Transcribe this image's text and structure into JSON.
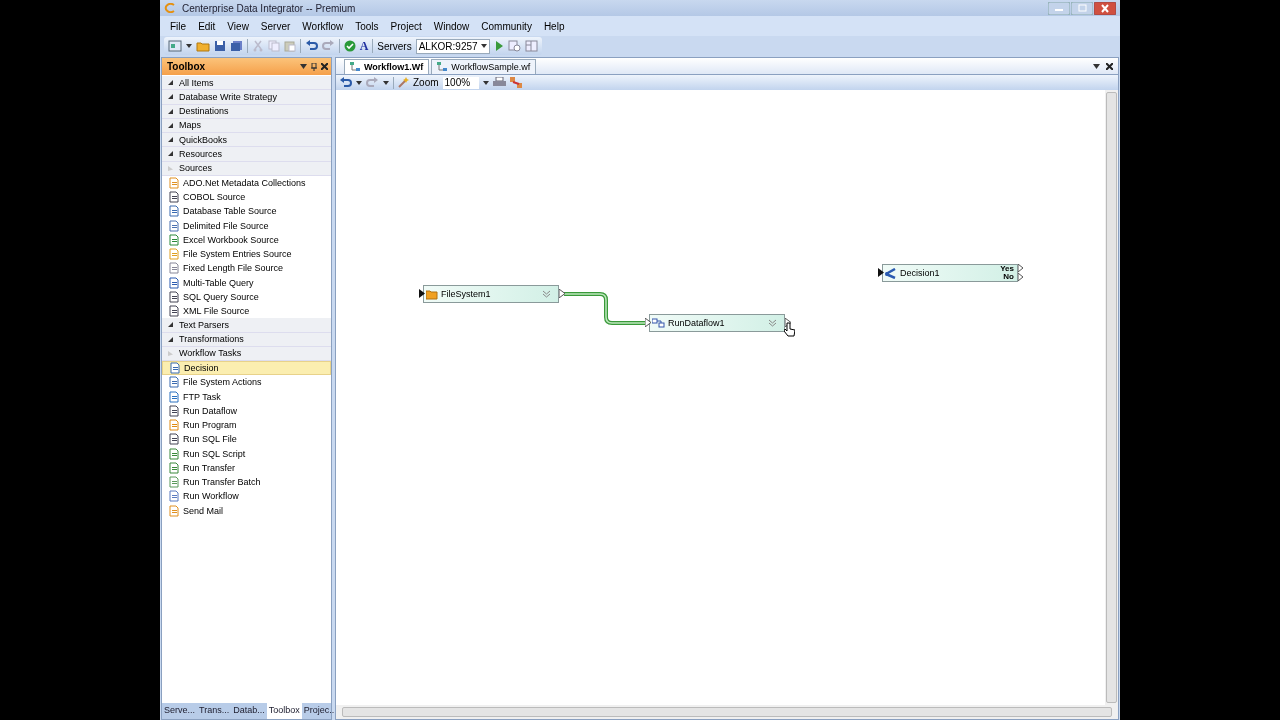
{
  "window": {
    "title": "Centerprise Data Integrator -- Premium"
  },
  "menu": [
    "File",
    "Edit",
    "View",
    "Server",
    "Workflow",
    "Tools",
    "Project",
    "Window",
    "Community",
    "Help"
  ],
  "toolbar": {
    "font_button": "A",
    "servers_label": "Servers",
    "server": "ALKOR:9257"
  },
  "toolbox": {
    "title": "Toolbox",
    "items": [
      {
        "kind": "category",
        "label": "All Items",
        "expanded": false
      },
      {
        "kind": "category",
        "label": "Database Write Strategy",
        "expanded": false
      },
      {
        "kind": "category",
        "label": "Destinations",
        "expanded": false
      },
      {
        "kind": "category",
        "label": "Maps",
        "expanded": false
      },
      {
        "kind": "category",
        "label": "QuickBooks",
        "expanded": false
      },
      {
        "kind": "category",
        "label": "Resources",
        "expanded": false
      },
      {
        "kind": "category",
        "label": "Sources",
        "expanded": true
      },
      {
        "kind": "tool",
        "label": "ADO.Net Metadata Collections",
        "selected": false
      },
      {
        "kind": "tool",
        "label": "COBOL Source",
        "selected": false
      },
      {
        "kind": "tool",
        "label": "Database Table Source",
        "selected": false
      },
      {
        "kind": "tool",
        "label": "Delimited File Source",
        "selected": false
      },
      {
        "kind": "tool",
        "label": "Excel Workbook Source",
        "selected": false
      },
      {
        "kind": "tool",
        "label": "File System Entries Source",
        "selected": false
      },
      {
        "kind": "tool",
        "label": "Fixed Length File Source",
        "selected": false
      },
      {
        "kind": "tool",
        "label": "Multi-Table Query",
        "selected": false
      },
      {
        "kind": "tool",
        "label": "SQL Query Source",
        "selected": false
      },
      {
        "kind": "tool",
        "label": "XML File Source",
        "selected": false
      },
      {
        "kind": "category",
        "label": "Text Parsers",
        "expanded": false
      },
      {
        "kind": "category",
        "label": "Transformations",
        "expanded": false
      },
      {
        "kind": "category",
        "label": "Workflow Tasks",
        "expanded": true
      },
      {
        "kind": "tool",
        "label": "Decision",
        "selected": true
      },
      {
        "kind": "tool",
        "label": "File System Actions",
        "selected": false
      },
      {
        "kind": "tool",
        "label": "FTP Task",
        "selected": false
      },
      {
        "kind": "tool",
        "label": "Run Dataflow",
        "selected": false
      },
      {
        "kind": "tool",
        "label": "Run Program",
        "selected": false
      },
      {
        "kind": "tool",
        "label": "Run SQL File",
        "selected": false
      },
      {
        "kind": "tool",
        "label": "Run SQL Script",
        "selected": false
      },
      {
        "kind": "tool",
        "label": "Run Transfer",
        "selected": false
      },
      {
        "kind": "tool",
        "label": "Run Transfer Batch",
        "selected": false
      },
      {
        "kind": "tool",
        "label": "Run Workflow",
        "selected": false
      },
      {
        "kind": "tool",
        "label": "Send Mail",
        "selected": false
      }
    ],
    "bottom_tabs": [
      {
        "label": "Serve...",
        "selected": false
      },
      {
        "label": "Trans...",
        "selected": false
      },
      {
        "label": "Datab...",
        "selected": false
      },
      {
        "label": "Toolbox",
        "selected": true
      },
      {
        "label": "Projec...",
        "selected": false
      }
    ]
  },
  "document_tabs": [
    {
      "label": "Workflow1.Wf",
      "selected": true
    },
    {
      "label": "WorkflowSample.wf",
      "selected": false
    }
  ],
  "document_toolbar": {
    "zoom_label": "Zoom",
    "zoom": "100%"
  },
  "nodes": [
    {
      "kind": "filesystem",
      "name": "FileSystem1",
      "link_next": true
    },
    {
      "kind": "dataflow",
      "name": "RunDataflow1"
    },
    {
      "kind": "decision",
      "name": "Decision1",
      "outputs": [
        "Yes",
        "No"
      ]
    }
  ]
}
